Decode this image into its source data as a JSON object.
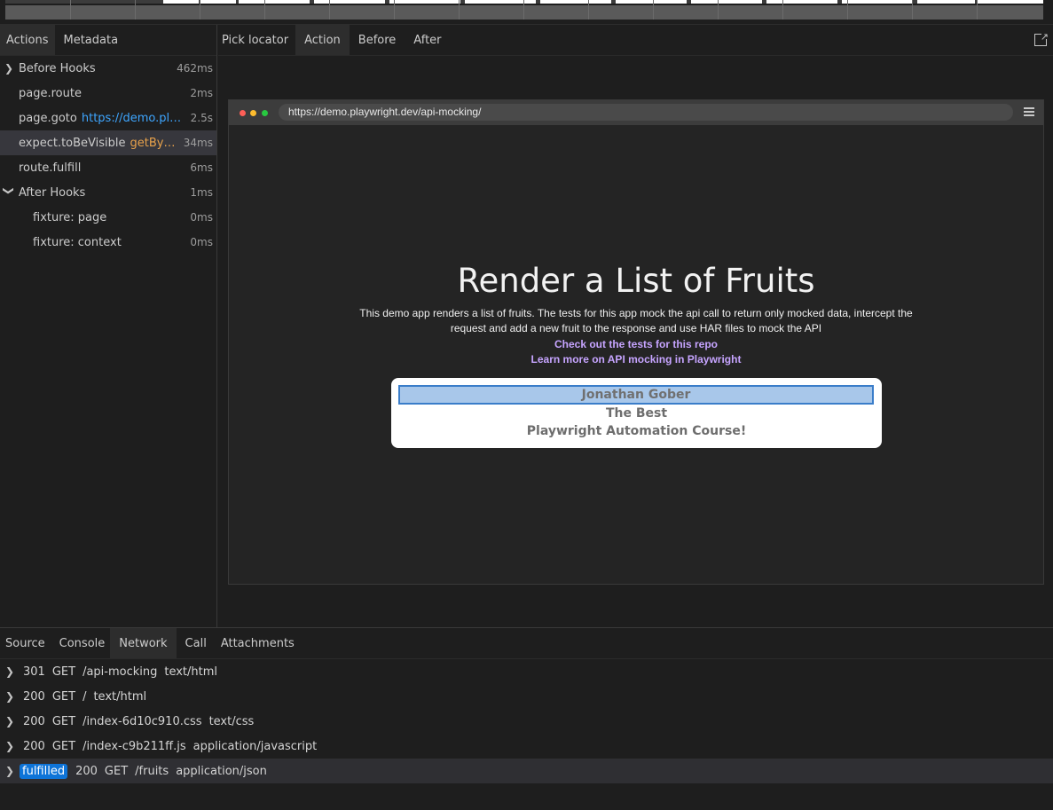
{
  "left_tabs": [
    "Actions",
    "Metadata"
  ],
  "actions": [
    {
      "title": "Before Hooks",
      "param": "",
      "duration": "462ms",
      "chevron": "right"
    },
    {
      "title": "page.route",
      "param": "",
      "duration": "2ms"
    },
    {
      "title": "page.goto",
      "param": "https://demo.playwri...",
      "duration": "2.5s"
    },
    {
      "title": "expect.toBeVisible",
      "param": "getByText('...",
      "duration": "34ms"
    },
    {
      "title": "route.fulfill",
      "param": "",
      "duration": "6ms"
    },
    {
      "title": "After Hooks",
      "param": "",
      "duration": "1ms",
      "chevron": "down"
    },
    {
      "title": "fixture: page",
      "param": "",
      "duration": "0ms"
    },
    {
      "title": "fixture: context",
      "param": "",
      "duration": "0ms"
    }
  ],
  "snapshot_tabs": {
    "pick_locator": "Pick locator",
    "action": "Action",
    "before": "Before",
    "after": "After"
  },
  "browser": {
    "url": "https://demo.playwright.dev/api-mocking/"
  },
  "page": {
    "title": "Render a List of Fruits",
    "description": "This demo app renders a list of fruits. The tests for this app mock the api call to return only mocked data, intercept the request and add a new fruit to the response and use HAR files to mock the API",
    "link1": "Check out the tests for this repo",
    "link2": "Learn more on API mocking in Playwright",
    "fruits": [
      "Jonathan Gober",
      "The Best",
      "Playwright Automation Course!"
    ]
  },
  "bottom_tabs": [
    "Source",
    "Console",
    "Network",
    "Call",
    "Attachments"
  ],
  "network": [
    {
      "badge": "",
      "status": "301",
      "method": "GET",
      "path": "/api-mocking",
      "type": "text/html"
    },
    {
      "badge": "",
      "status": "200",
      "method": "GET",
      "path": "/",
      "type": "text/html"
    },
    {
      "badge": "",
      "status": "200",
      "method": "GET",
      "path": "/index-6d10c910.css",
      "type": "text/css"
    },
    {
      "badge": "",
      "status": "200",
      "method": "GET",
      "path": "/index-c9b211ff.js",
      "type": "application/javascript"
    },
    {
      "badge": "fulfilled",
      "status": "200",
      "method": "GET",
      "path": "/fruits",
      "type": "application/json"
    }
  ],
  "colors": {
    "accent_blue": "#0e74d8",
    "param_blue": "#3ea6ff",
    "param_orange": "#e8a24b",
    "link_purple": "#c6a4ff"
  }
}
